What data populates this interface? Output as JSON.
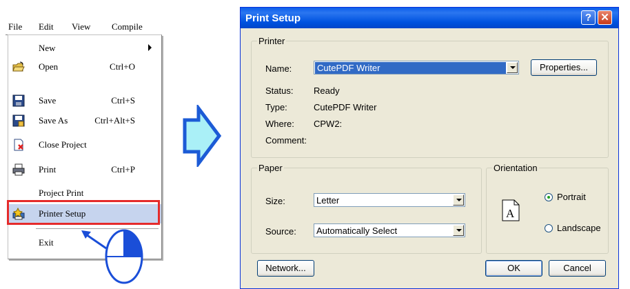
{
  "menubar": {
    "file": "File",
    "edit": "Edit",
    "view": "View",
    "compile": "Compile"
  },
  "menu": {
    "items": [
      {
        "label": "New",
        "shortcut": "",
        "icon": "none",
        "submenu": true
      },
      {
        "label": "Open",
        "shortcut": "Ctrl+O",
        "icon": "open-folder-icon"
      },
      {
        "label": "Save",
        "shortcut": "Ctrl+S",
        "icon": "save-disk-icon"
      },
      {
        "label": "Save As",
        "shortcut": "Ctrl+Alt+S",
        "icon": "save-as-icon"
      },
      {
        "label": "Close Project",
        "shortcut": "",
        "icon": "close-project-icon"
      },
      {
        "label": "Print",
        "shortcut": "Ctrl+P",
        "icon": "printer-icon"
      },
      {
        "label": "Project Print",
        "shortcut": "",
        "icon": "none"
      },
      {
        "label": "Printer Setup",
        "shortcut": "",
        "icon": "printer-setup-icon",
        "highlighted": true
      },
      {
        "label": "Exit",
        "shortcut": "",
        "icon": "none"
      }
    ]
  },
  "dialog": {
    "title": "Print Setup",
    "printer": {
      "group_title": "Printer",
      "name_label": "Name:",
      "name_value": "CutePDF Writer",
      "properties_button": "Properties...",
      "status_label": "Status:",
      "status_value": "Ready",
      "type_label": "Type:",
      "type_value": "CutePDF Writer",
      "where_label": "Where:",
      "where_value": "CPW2:",
      "comment_label": "Comment:"
    },
    "paper": {
      "group_title": "Paper",
      "size_label": "Size:",
      "size_value": "Letter",
      "source_label": "Source:",
      "source_value": "Automatically Select"
    },
    "orientation": {
      "group_title": "Orientation",
      "portrait_label": "Portrait",
      "landscape_label": "Landscape",
      "selected": "Portrait",
      "page_glyph": "A"
    },
    "buttons": {
      "network": "Network...",
      "ok": "OK",
      "cancel": "Cancel"
    }
  },
  "colors": {
    "highlight_box": "#e52b2b",
    "arrow_fill": "#aaf0f7",
    "arrow_stroke": "#1c5bd6",
    "titlebar": "#0a5eea"
  }
}
